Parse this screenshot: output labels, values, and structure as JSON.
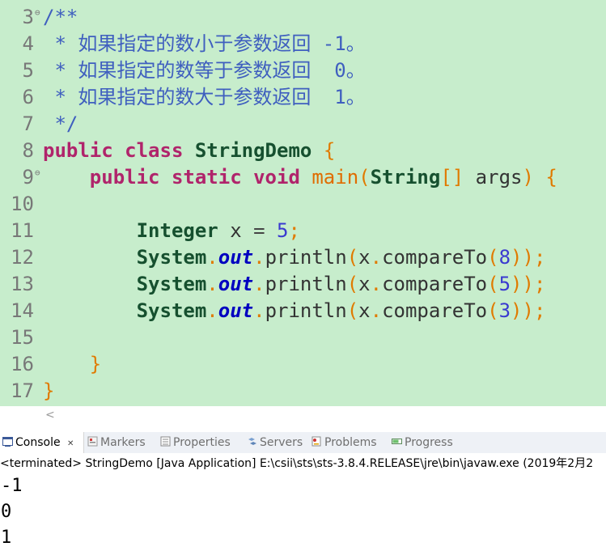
{
  "editor": {
    "lines": [
      {
        "n": "3",
        "fold": "⊖",
        "tokens": [
          {
            "c": "cmt",
            "t": "/**"
          }
        ]
      },
      {
        "n": "4",
        "fold": "",
        "tokens": [
          {
            "c": "cmt",
            "t": " * 如果指定的数小于参数返回 -1。"
          }
        ]
      },
      {
        "n": "5",
        "fold": "",
        "tokens": [
          {
            "c": "cmt",
            "t": " * 如果指定的数等于参数返回  0。"
          }
        ]
      },
      {
        "n": "6",
        "fold": "",
        "tokens": [
          {
            "c": "cmt",
            "t": " * 如果指定的数大于参数返回  1。"
          }
        ]
      },
      {
        "n": "7",
        "fold": "",
        "tokens": [
          {
            "c": "cmt",
            "t": " */"
          }
        ]
      },
      {
        "n": "8",
        "fold": "",
        "tokens": [
          {
            "c": "kw",
            "t": "public"
          },
          {
            "c": "plain",
            "t": " "
          },
          {
            "c": "kw",
            "t": "class"
          },
          {
            "c": "plain",
            "t": " "
          },
          {
            "c": "ty",
            "t": "StringDemo"
          },
          {
            "c": "plain",
            "t": " "
          },
          {
            "c": "br",
            "t": "{"
          }
        ]
      },
      {
        "n": "9",
        "fold": "⊖",
        "tokens": [
          {
            "c": "plain",
            "t": "    "
          },
          {
            "c": "kw",
            "t": "public"
          },
          {
            "c": "plain",
            "t": " "
          },
          {
            "c": "kw",
            "t": "static"
          },
          {
            "c": "plain",
            "t": " "
          },
          {
            "c": "kw",
            "t": "void"
          },
          {
            "c": "plain",
            "t": " "
          },
          {
            "c": "fn",
            "t": "main"
          },
          {
            "c": "br",
            "t": "("
          },
          {
            "c": "ty",
            "t": "String"
          },
          {
            "c": "br",
            "t": "[]"
          },
          {
            "c": "plain",
            "t": " args"
          },
          {
            "c": "br",
            "t": ")"
          },
          {
            "c": "plain",
            "t": " "
          },
          {
            "c": "br",
            "t": "{"
          }
        ]
      },
      {
        "n": "10",
        "fold": "",
        "tokens": []
      },
      {
        "n": "11",
        "fold": "",
        "tokens": [
          {
            "c": "plain",
            "t": "        "
          },
          {
            "c": "ty",
            "t": "Integer"
          },
          {
            "c": "plain",
            "t": " x "
          },
          {
            "c": "pun",
            "t": "="
          },
          {
            "c": "plain",
            "t": " "
          },
          {
            "c": "num",
            "t": "5"
          },
          {
            "c": "semi",
            "t": ";"
          }
        ]
      },
      {
        "n": "12",
        "fold": "",
        "tokens": [
          {
            "c": "plain",
            "t": "        "
          },
          {
            "c": "ty",
            "t": "System"
          },
          {
            "c": "br",
            "t": "."
          },
          {
            "c": "fld",
            "t": "out"
          },
          {
            "c": "br",
            "t": "."
          },
          {
            "c": "plain",
            "t": "println"
          },
          {
            "c": "br",
            "t": "("
          },
          {
            "c": "plain",
            "t": "x"
          },
          {
            "c": "br",
            "t": "."
          },
          {
            "c": "plain",
            "t": "compareTo"
          },
          {
            "c": "br",
            "t": "("
          },
          {
            "c": "num",
            "t": "8"
          },
          {
            "c": "br",
            "t": "))"
          },
          {
            "c": "semi",
            "t": ";"
          }
        ]
      },
      {
        "n": "13",
        "fold": "",
        "tokens": [
          {
            "c": "plain",
            "t": "        "
          },
          {
            "c": "ty",
            "t": "System"
          },
          {
            "c": "br",
            "t": "."
          },
          {
            "c": "fld",
            "t": "out"
          },
          {
            "c": "br",
            "t": "."
          },
          {
            "c": "plain",
            "t": "println"
          },
          {
            "c": "br",
            "t": "("
          },
          {
            "c": "plain",
            "t": "x"
          },
          {
            "c": "br",
            "t": "."
          },
          {
            "c": "plain",
            "t": "compareTo"
          },
          {
            "c": "br",
            "t": "("
          },
          {
            "c": "num",
            "t": "5"
          },
          {
            "c": "br",
            "t": "))"
          },
          {
            "c": "semi",
            "t": ";"
          }
        ]
      },
      {
        "n": "14",
        "fold": "",
        "tokens": [
          {
            "c": "plain",
            "t": "        "
          },
          {
            "c": "ty",
            "t": "System"
          },
          {
            "c": "br",
            "t": "."
          },
          {
            "c": "fld",
            "t": "out"
          },
          {
            "c": "br",
            "t": "."
          },
          {
            "c": "plain",
            "t": "println"
          },
          {
            "c": "br",
            "t": "("
          },
          {
            "c": "plain",
            "t": "x"
          },
          {
            "c": "br",
            "t": "."
          },
          {
            "c": "plain",
            "t": "compareTo"
          },
          {
            "c": "br",
            "t": "("
          },
          {
            "c": "num",
            "t": "3"
          },
          {
            "c": "br",
            "t": "))"
          },
          {
            "c": "semi",
            "t": ";"
          }
        ]
      },
      {
        "n": "15",
        "fold": "",
        "tokens": []
      },
      {
        "n": "16",
        "fold": "",
        "tokens": [
          {
            "c": "plain",
            "t": "    "
          },
          {
            "c": "br",
            "t": "}"
          }
        ]
      },
      {
        "n": "17",
        "fold": "",
        "tokens": [
          {
            "c": "br",
            "t": "}"
          }
        ]
      }
    ],
    "scroll_left_glyph": "<"
  },
  "tabs": [
    {
      "label": "Console",
      "icon": "console-icon",
      "active": true,
      "close": "✕"
    },
    {
      "label": "Markers",
      "icon": "markers-icon",
      "active": false
    },
    {
      "label": "Properties",
      "icon": "properties-icon",
      "active": false
    },
    {
      "label": "Servers",
      "icon": "servers-icon",
      "active": false
    },
    {
      "label": "Problems",
      "icon": "problems-icon",
      "active": false
    },
    {
      "label": "Progress",
      "icon": "progress-icon",
      "active": false
    }
  ],
  "console": {
    "status": "<terminated> StringDemo [Java Application] E:\\csii\\sts\\sts-3.8.4.RELEASE\\jre\\bin\\javaw.exe (2019年2月2",
    "output": [
      "-1",
      "0",
      "1"
    ]
  },
  "colors": {
    "editor_bg": "#c7edcc",
    "keyword": "#b0246b",
    "comment": "#3f5fbf",
    "type": "#16502f",
    "bracket": "#e07a00"
  }
}
